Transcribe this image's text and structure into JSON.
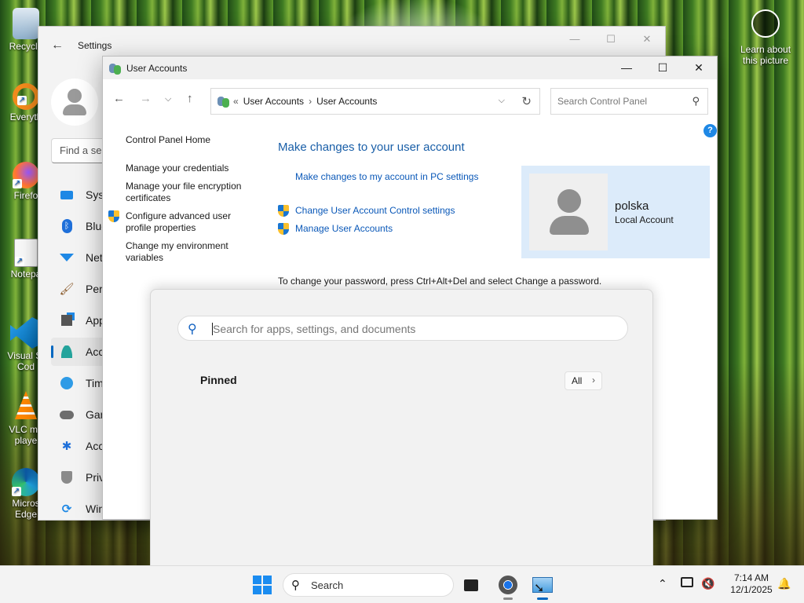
{
  "desktop": {
    "icons": [
      {
        "label": "Recycle"
      },
      {
        "label": "Everyth"
      },
      {
        "label": "Firefo"
      },
      {
        "label": "Notepa"
      },
      {
        "label": "Visual St Cod"
      },
      {
        "label": "VLC me playe"
      },
      {
        "label": "Micros Edge"
      }
    ],
    "learn_label": "Learn about this picture"
  },
  "settings_window": {
    "title": "Settings",
    "search_placeholder": "Find a se",
    "nav": [
      {
        "label": "Syst",
        "icon": "monitor-icon"
      },
      {
        "label": "Blue",
        "icon": "bluetooth-icon"
      },
      {
        "label": "Net",
        "icon": "wifi-icon"
      },
      {
        "label": "Pers",
        "icon": "brush-icon"
      },
      {
        "label": "App",
        "icon": "apps-icon"
      },
      {
        "label": "Acc",
        "icon": "person-icon"
      },
      {
        "label": "Tim",
        "icon": "clock-icon"
      },
      {
        "label": "Gan",
        "icon": "gamepad-icon"
      },
      {
        "label": "Acc",
        "icon": "accessibility-icon"
      },
      {
        "label": "Priv",
        "icon": "shield-icon"
      },
      {
        "label": "Win",
        "icon": "update-icon"
      }
    ],
    "selected_index": 5
  },
  "user_accounts": {
    "title": "User Accounts",
    "breadcrumb": [
      "User Accounts",
      "User Accounts"
    ],
    "breadcrumb_prefix": "«",
    "search_placeholder": "Search Control Panel",
    "help": "?",
    "left_links": {
      "home": "Control Panel Home",
      "credentials": "Manage your credentials",
      "encryption": "Manage your file encryption certificates",
      "profile": "Configure advanced user profile properties",
      "environment": "Change my environment variables"
    },
    "heading": "Make changes to your user account",
    "pc_settings_link": "Make changes to my account in PC settings",
    "uac_link": "Change User Account Control settings",
    "manage_link": "Manage User Accounts",
    "account": {
      "name": "polska",
      "type": "Local Account"
    },
    "password_note": "To change your password, press Ctrl+Alt+Del and select Change a password."
  },
  "start_menu": {
    "search_placeholder": "Search for apps, settings, and documents",
    "pinned_label": "Pinned",
    "all_label": "All"
  },
  "taskbar": {
    "search_label": "Search",
    "time": "7:14 AM",
    "date": "12/1/2025"
  }
}
